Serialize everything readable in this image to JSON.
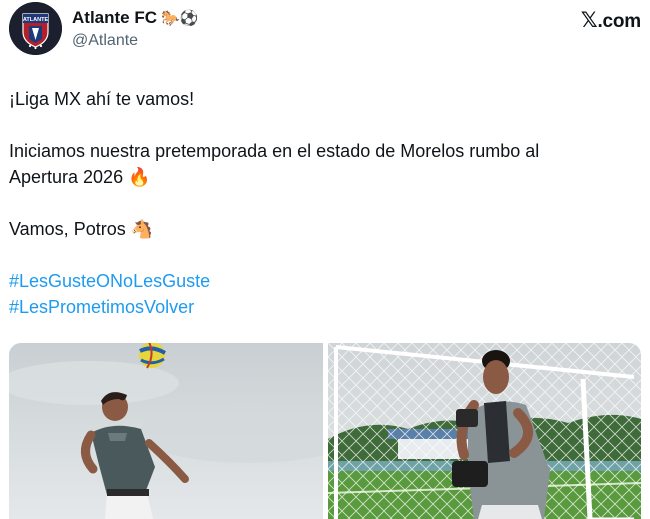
{
  "header": {
    "display_name": "Atlante FC",
    "name_emojis": "🐎⚽",
    "handle": "@Atlante",
    "avatar_text": "ATLANTE",
    "platform_logo": "𝕏",
    "platform_text": ".com"
  },
  "post": {
    "line1": "¡Liga MX ahí te vamos!",
    "line2": "Iniciamos nuestra pretemporada en el estado de Morelos rumbo al",
    "line3": "Apertura 2026 🔥",
    "line4": "Vamos, Potros 🐴",
    "hashtags": [
      "#LesGusteONoLesGuste",
      "#LesPrometimosVolver"
    ]
  },
  "media": {
    "photos": [
      {
        "icon": "player-heading-ball-photo"
      },
      {
        "icon": "goalkeeper-training-photo"
      }
    ]
  },
  "colors": {
    "hashtag": "#1d9bf0",
    "secondary_text": "#536471",
    "avatar_bg": "#1b1f2e",
    "crest_red": "#b3202a",
    "crest_blue": "#1f3a7a"
  }
}
